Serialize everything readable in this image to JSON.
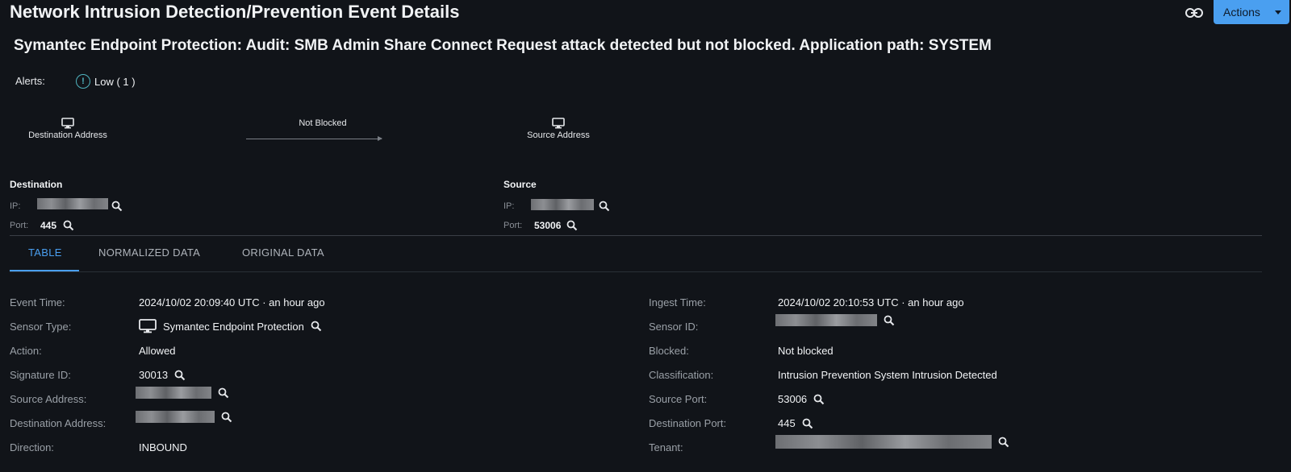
{
  "header": {
    "title": "Network Intrusion Detection/Prevention Event Details",
    "actions_label": "Actions"
  },
  "event_heading": "Symantec Endpoint Protection: Audit: SMB Admin Share Connect Request attack detected but not blocked. Application path: SYSTEM",
  "alerts": {
    "label": "Alerts:",
    "badge_text": "Low ( 1 )",
    "icon_color": "#4fb3bf"
  },
  "flow": {
    "left_node": "Destination Address",
    "right_node": "Source Address",
    "status": "Not Blocked"
  },
  "destination": {
    "title": "Destination",
    "ip_label": "IP:",
    "port_label": "Port:",
    "port": "445"
  },
  "source": {
    "title": "Source",
    "ip_label": "IP:",
    "port_label": "Port:",
    "port": "53006"
  },
  "tabs": [
    {
      "label": "TABLE",
      "active": true
    },
    {
      "label": "NORMALIZED DATA",
      "active": false
    },
    {
      "label": "ORIGINAL DATA",
      "active": false
    }
  ],
  "details_left": [
    {
      "label": "Event Time:",
      "value": "2024/10/02 20:09:40 UTC · an hour ago"
    },
    {
      "label": "Sensor Type:",
      "value": "Symantec Endpoint Protection"
    },
    {
      "label": "Action:",
      "value": "Allowed"
    },
    {
      "label": "Signature ID:",
      "value": "30013"
    },
    {
      "label": "Source Address:",
      "value": ""
    },
    {
      "label": "Destination Address:",
      "value": ""
    },
    {
      "label": "Direction:",
      "value": "INBOUND"
    }
  ],
  "details_right": [
    {
      "label": "Ingest Time:",
      "value": "2024/10/02 20:10:53 UTC · an hour ago"
    },
    {
      "label": "Sensor ID:",
      "value": ""
    },
    {
      "label": "Blocked:",
      "value": "Not blocked"
    },
    {
      "label": "Classification:",
      "value": "Intrusion Prevention System Intrusion Detected"
    },
    {
      "label": "Source Port:",
      "value": "53006"
    },
    {
      "label": "Destination Port:",
      "value": "445"
    },
    {
      "label": "Tenant:",
      "value": ""
    }
  ],
  "colors": {
    "background": "#111419",
    "accent": "#4a9ff0",
    "text": "#e6e8eb",
    "muted": "#9aa0a7"
  }
}
